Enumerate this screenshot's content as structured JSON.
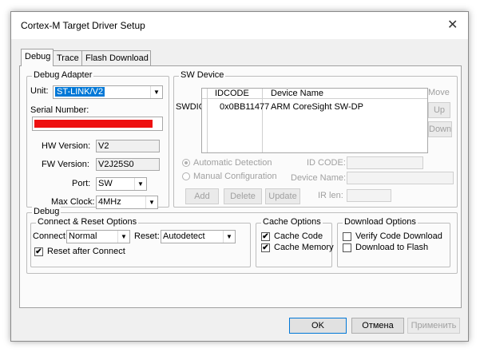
{
  "window": {
    "title": "Cortex-M Target Driver Setup",
    "close": "✕"
  },
  "tabs": [
    {
      "label": "Debug",
      "active": true
    },
    {
      "label": "Trace",
      "active": false
    },
    {
      "label": "Flash Download",
      "active": false
    }
  ],
  "debug_adapter": {
    "legend": "Debug Adapter",
    "unit_label": "Unit:",
    "unit_value": "ST-LINK/V2",
    "serial_label": "Serial Number:",
    "serial_redacted_color": "#ee1111",
    "hw_label": "HW Version:",
    "hw_value": "V2",
    "fw_label": "FW Version:",
    "fw_value": "V2J25S0",
    "port_label": "Port:",
    "port_value": "SW",
    "clock_label": "Max Clock:",
    "clock_value": "4MHz"
  },
  "sw_device": {
    "legend": "SW Device",
    "row_label": "SWDIO",
    "columns": [
      "IDCODE",
      "Device Name"
    ],
    "rows": [
      {
        "idcode": "0x0BB11477",
        "device": "ARM CoreSight SW-DP"
      }
    ],
    "move_label": "Move",
    "up_label": "Up",
    "down_label": "Down",
    "auto_detect": "Automatic Detection",
    "manual_config": "Manual Configuration",
    "id_code_label": "ID CODE:",
    "device_name_label": "Device Name:",
    "ir_len_label": "IR len:",
    "add_label": "Add",
    "delete_label": "Delete",
    "update_label": "Update"
  },
  "debug": {
    "legend": "Debug",
    "connect_reset": {
      "legend": "Connect & Reset Options",
      "connect_label": "Connect:",
      "connect_value": "Normal",
      "reset_label": "Reset:",
      "reset_value": "Autodetect",
      "reset_after_connect": "Reset after Connect",
      "reset_after_connect_checked": true
    },
    "cache": {
      "legend": "Cache Options",
      "cache_code": "Cache Code",
      "cache_code_checked": true,
      "cache_memory": "Cache Memory",
      "cache_memory_checked": true
    },
    "download": {
      "legend": "Download Options",
      "verify": "Verify Code Download",
      "verify_checked": false,
      "download_flash": "Download to Flash",
      "download_flash_checked": false
    }
  },
  "footer": {
    "ok": "OK",
    "cancel": "Отмена",
    "apply": "Применить"
  },
  "check_mark": "✔",
  "dropdown_arrow": "▼"
}
